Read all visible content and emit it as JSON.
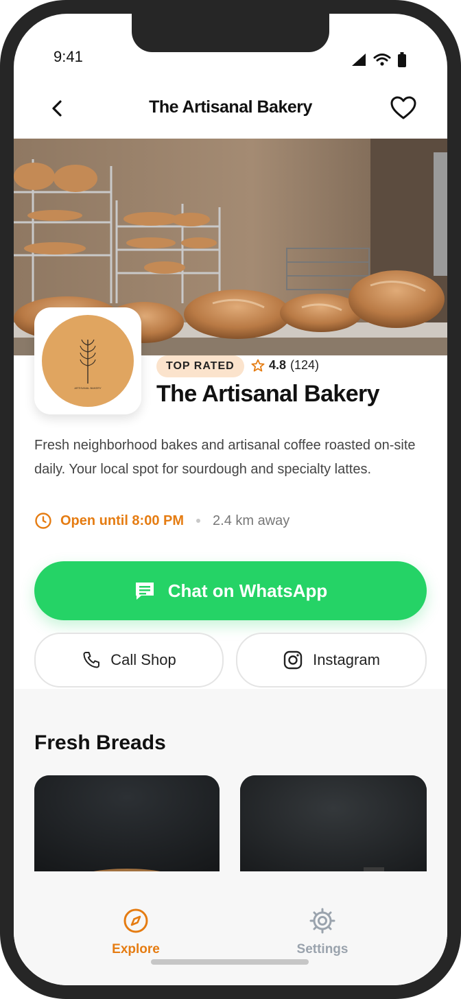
{
  "status": {
    "time": "9:41"
  },
  "header": {
    "title": "The Artisanal Bakery"
  },
  "shop": {
    "badge": "TOP RATED",
    "rating": "4.8",
    "reviews": "(124)",
    "name": "The Artisanal Bakery",
    "description": "Fresh neighborhood bakes and artisanal coffee roasted on-site daily. Your local spot for sourdough and specialty lattes.",
    "hours": "Open until 8:00 PM",
    "distance": "2.4 km away",
    "logo_text": "ARTISANAL BAKERY"
  },
  "actions": {
    "whatsapp": "Chat on WhatsApp",
    "call": "Call Shop",
    "instagram": "Instagram"
  },
  "section": {
    "title": "Fresh Breads"
  },
  "tabs": [
    {
      "label": "Explore",
      "icon": "compass-icon",
      "active": true
    },
    {
      "label": "Settings",
      "icon": "gear-icon",
      "active": false
    }
  ],
  "colors": {
    "accent": "#e57c12",
    "whatsapp": "#25d366",
    "badge_bg": "#fbe3cc"
  }
}
